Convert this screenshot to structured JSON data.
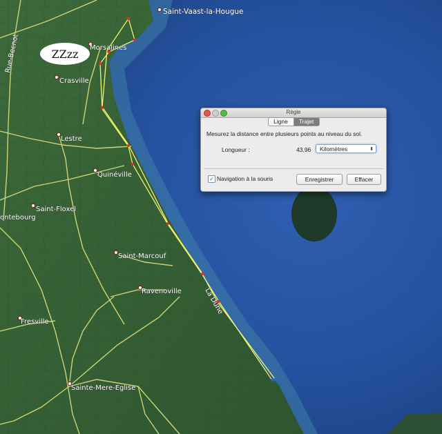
{
  "map": {
    "places": [
      {
        "name": "Saint-Vaast-la-Hougue"
      },
      {
        "name": "Morsalines"
      },
      {
        "name": "Crasville"
      },
      {
        "name": "Lestre"
      },
      {
        "name": "Quinéville"
      },
      {
        "name": "Saint-Floxel"
      },
      {
        "name": "ontebourg"
      },
      {
        "name": "Saint-Marcouf"
      },
      {
        "name": "Ravenoville"
      },
      {
        "name": "Fresville"
      },
      {
        "name": "Sainte-Mere-Eglise"
      }
    ],
    "road_labels": [
      "Rue-Becnot",
      "La Dune"
    ]
  },
  "bubble": {
    "text": "ZZzz"
  },
  "dialog": {
    "title": "Règle",
    "tabs": [
      {
        "label": "Ligne",
        "selected": false
      },
      {
        "label": "Trajet",
        "selected": true
      }
    ],
    "description": "Mesurez la distance entre plusieurs points au niveau du sol.",
    "length_label": "Longueur :",
    "length_value": "43,96",
    "unit": {
      "selected": "Kilomètres",
      "arrow": "⬍"
    },
    "nav_checkbox": {
      "label": "Navigation à la souris",
      "checked": true,
      "mark": "✓"
    },
    "buttons": {
      "save": "Enregistrer",
      "clear": "Effacer"
    }
  }
}
